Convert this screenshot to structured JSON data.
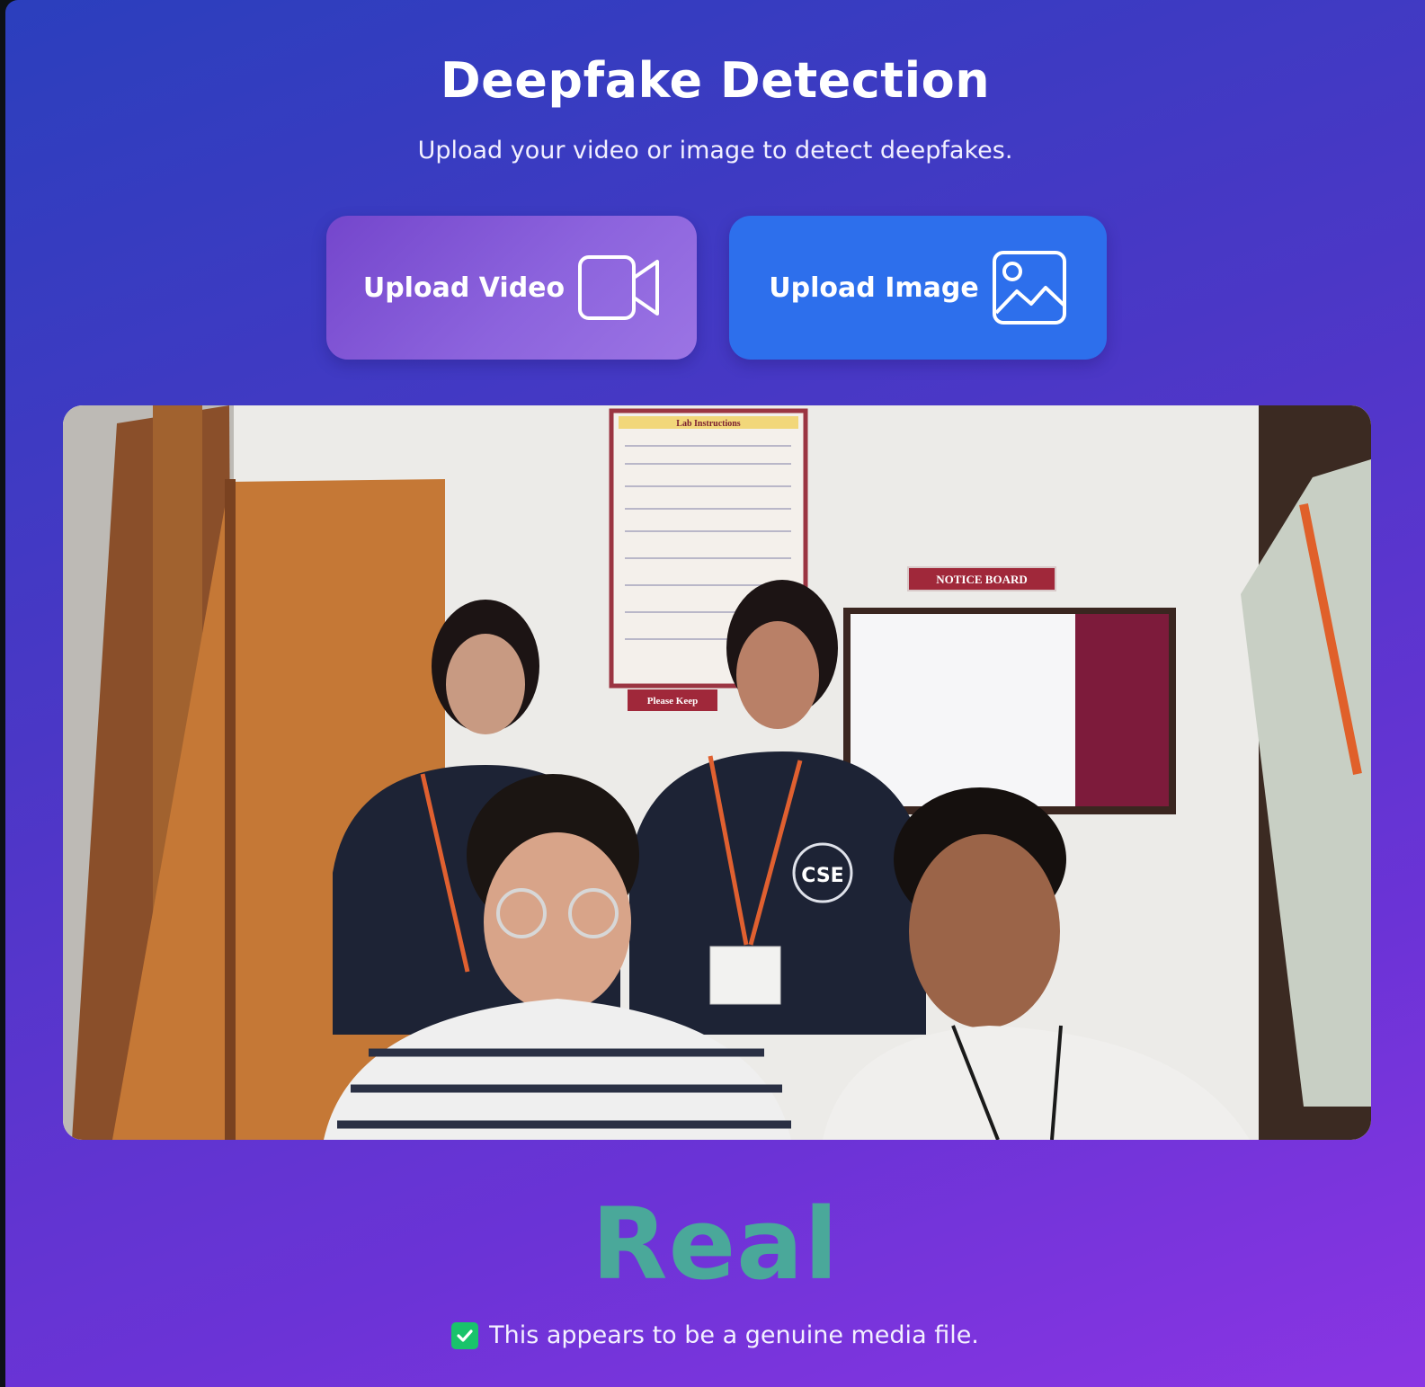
{
  "header": {
    "title": "Deepfake Detection",
    "subtitle": "Upload your video or image to detect deepfakes."
  },
  "actions": {
    "upload_video_label": "Upload Video",
    "upload_video_icon": "video-camera-icon",
    "upload_image_label": "Upload Image",
    "upload_image_icon": "image-icon"
  },
  "preview": {
    "scene_labels": {
      "poster_title": "Lab Instructions",
      "notice_board": "NOTICE BOARD",
      "keep_sign": "Please Keep",
      "shirt_logo": "CSE"
    }
  },
  "result": {
    "label": "Real",
    "message": "This appears to be a genuine media file.",
    "status_icon": "check-icon",
    "color": "#4aa89a"
  }
}
